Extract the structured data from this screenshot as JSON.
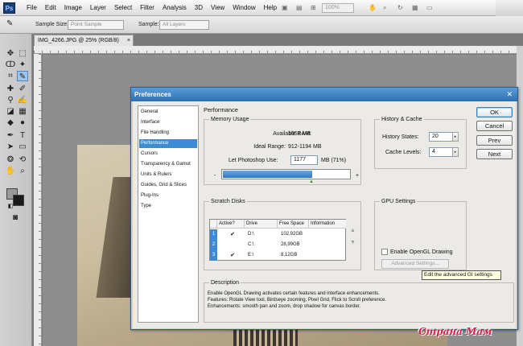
{
  "menubar": {
    "logo": "Ps",
    "items": [
      "File",
      "Edit",
      "Image",
      "Layer",
      "Select",
      "Filter",
      "Analysis",
      "3D",
      "View",
      "Window",
      "Help"
    ],
    "zoom": "100%"
  },
  "options_bar": {
    "sample_size_label": "Sample Size:",
    "sample_size_value": "Point Sample",
    "sample_label": "Sample:",
    "sample_value": "All Layers"
  },
  "document": {
    "tab_title": "IMG_4266.JPG @ 25% (RGB/8)",
    "tab_close": "×"
  },
  "preferences": {
    "title": "Preferences",
    "close": "✕",
    "categories": [
      "General",
      "Interface",
      "File Handling",
      "Performance",
      "Cursors",
      "Transparency & Gamut",
      "Units & Rulers",
      "Guides, Grid & Slices",
      "Plug-Ins",
      "Type"
    ],
    "selected_category": "Performance",
    "section_title": "Performance",
    "memory": {
      "group_label": "Memory Usage",
      "available_ram_label": "Available RAM:",
      "available_ram_value": "1658 MB",
      "ideal_range_label": "Ideal Range:",
      "ideal_range_value": "912-1194 MB",
      "let_photoshop_label": "Let Photoshop Use:",
      "let_photoshop_value": "1177",
      "let_photoshop_unit": "MB (71%)",
      "slider_fraction": 0.71,
      "minus": "-",
      "plus": "+"
    },
    "history": {
      "group_label": "History & Cache",
      "history_states_label": "History States:",
      "history_states_value": "20",
      "cache_levels_label": "Cache Levels:",
      "cache_levels_value": "4"
    },
    "scratch": {
      "group_label": "Scratch Disks",
      "headers": [
        "Active?",
        "Drive",
        "Free Space",
        "Information"
      ],
      "rows": [
        {
          "num": "1",
          "active": "✔",
          "drive": "D:\\",
          "free": "102,92GB",
          "info": ""
        },
        {
          "num": "2",
          "active": "",
          "drive": "C:\\",
          "free": "28,99GB",
          "info": ""
        },
        {
          "num": "3",
          "active": "✔",
          "drive": "E:\\",
          "free": "8,12GB",
          "info": ""
        }
      ]
    },
    "gpu": {
      "group_label": "GPU Settings",
      "enable_opengl_label": "Enable OpenGL Drawing",
      "advanced_button": "Advanced Settings..."
    },
    "description": {
      "group_label": "Description",
      "lines": [
        "Enable OpenGL Drawing activates certain features and interface enhancements.",
        "Features: Rotate View tool, Birdseye zooming, Pixel Grid, Flick to Scroll preference.",
        "Enhancements: smooth pan and zoom, drop shadow for canvas border."
      ]
    },
    "buttons": {
      "ok": "OK",
      "cancel": "Cancel",
      "prev": "Prev",
      "next": "Next"
    },
    "tooltip": "Edit the advanced GI settings"
  },
  "watermark": "Страна Мам"
}
